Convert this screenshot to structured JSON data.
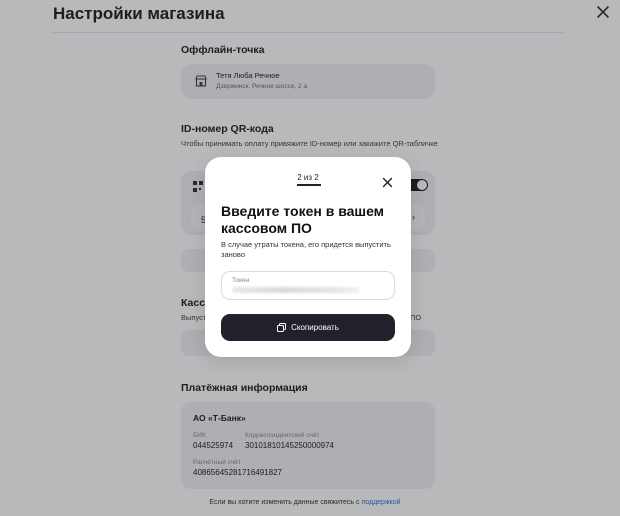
{
  "page": {
    "title": "Настройки магазина",
    "offline_point": {
      "section_title": "Оффлайн-точка",
      "name": "Тетя Люба Речное",
      "address": "Дзержинск, Речное шоссе, 2 а"
    },
    "qr": {
      "section_title": "ID-номер QR-кода",
      "description": "Чтобы принимать оплату привяжите ID-номер или закажите QR-табличке"
    },
    "kassa": {
      "section_title": "Кассо",
      "description_left": "Выпуст",
      "description_right": "ПО"
    },
    "payment": {
      "section_title": "Платёжная информация",
      "bank_name": "АО «Т-Банк»",
      "bik_label": "БИК",
      "bik_value": "044525974",
      "korr_label": "Корреспондентский счёт",
      "korr_value": "30101810145250000974",
      "account_label": "Расчётный счёт",
      "account_value": "40865645281716491827"
    },
    "support": {
      "text_before": "Если вы хотите изменить данные свяжитесь с ",
      "link_label": "поддержкой"
    }
  },
  "modal": {
    "step_label": "2 из 2",
    "title": "Введите токен в вашем кассовом ПО",
    "description": "В случае утраты токена, его придется выпустить заново",
    "token_field": {
      "label": "Токен",
      "value": ""
    },
    "copy_button_label": "Скопировать"
  },
  "colors": {
    "overlay": "#14161e4d",
    "button_dark": "#21212b",
    "card_bg": "#f0f1f4",
    "link": "#3b6fe0"
  },
  "icons": {
    "close": "close-icon",
    "shop": "shop-icon",
    "copy": "copy-icon"
  }
}
